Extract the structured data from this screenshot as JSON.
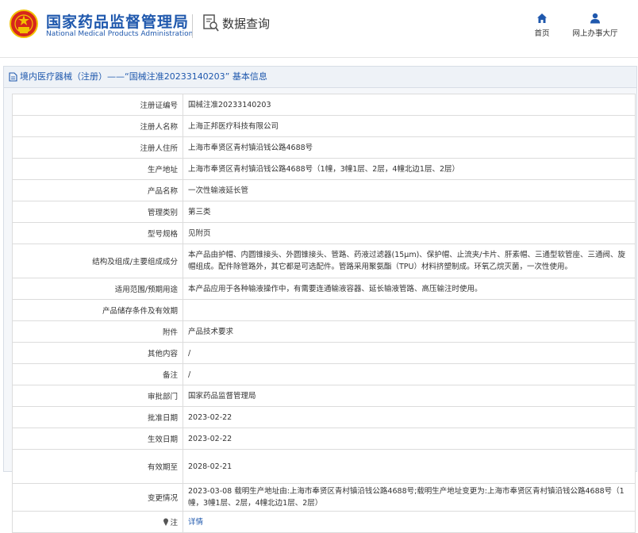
{
  "header": {
    "org_name_cn": "国家药品监督管理局",
    "org_name_en": "National Medical Products Administration",
    "query_title": "数据查询",
    "nav": [
      {
        "label": "首页",
        "icon": "home-icon"
      },
      {
        "label": "网上办事大厅",
        "icon": "user-icon"
      }
    ]
  },
  "panel": {
    "title": "境内医疗器械（注册）——“国械注准20233140203” 基本信息",
    "rows": [
      {
        "key": "注册证编号",
        "value": "国械注准20233140203"
      },
      {
        "key": "注册人名称",
        "value": "上海正邦医疗科技有限公司"
      },
      {
        "key": "注册人住所",
        "value": "上海市奉贤区青村镇沿钱公路4688号"
      },
      {
        "key": "生产地址",
        "value": "上海市奉贤区青村镇沿钱公路4688号（1幢，3幢1层、2层，4幢北边1层、2层）"
      },
      {
        "key": "产品名称",
        "value": "一次性输液延长管"
      },
      {
        "key": "管理类别",
        "value": "第三类"
      },
      {
        "key": "型号规格",
        "value": "见附页"
      },
      {
        "key": "结构及组成/主要组成成分",
        "value": "本产品由护帽、内圆锥接头、外圆锥接头、管路、药液过滤器(15μm)、保护帽、止流夹/卡片、肝素帽、三通型软管座、三通阀、旋帽组成。配件除管路外，其它都是可选配件。管路采用聚氨酯（TPU）材料挤塑制成。环氧乙烷灭菌，一次性使用。"
      },
      {
        "key": "适用范围/预期用途",
        "value": "本产品应用于各种输液操作中，有需要连通输液容器、延长输液管路、高压输注时使用。"
      },
      {
        "key": "产品储存条件及有效期",
        "value": ""
      },
      {
        "key": "附件",
        "value": "产品技术要求"
      },
      {
        "key": "其他内容",
        "value": "/"
      },
      {
        "key": "备注",
        "value": "/"
      },
      {
        "key": "审批部门",
        "value": "国家药品监督管理局"
      },
      {
        "key": "批准日期",
        "value": "2023-02-22"
      },
      {
        "key": "生效日期",
        "value": "2023-02-22"
      },
      {
        "key": "有效期至",
        "value": "2028-02-21"
      },
      {
        "key": "变更情况",
        "value": "2023-03-08 载明生产地址由:上海市奉贤区青村镇沿钱公路4688号;载明生产地址变更为:上海市奉贤区青村镇沿钱公路4688号（1幢，3幢1层、2层，4幢北边1层、2层）"
      }
    ],
    "note_row": {
      "key": "注",
      "value": "详情",
      "icon": "pin-icon"
    }
  },
  "colors": {
    "brand_blue": "#1f58ad",
    "emblem_red": "#d7261c",
    "emblem_gold": "#f2c200"
  }
}
